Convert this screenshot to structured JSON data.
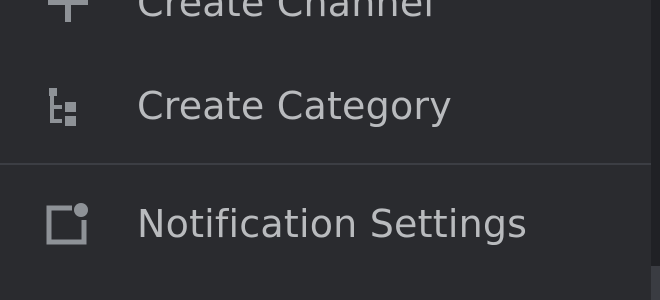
{
  "menu": {
    "items": [
      {
        "label": "Create Channel",
        "icon": "plus-icon"
      },
      {
        "label": "Create Category",
        "icon": "category-icon"
      },
      {
        "label": "Notification Settings",
        "icon": "notification-settings-icon"
      }
    ]
  },
  "colors": {
    "background": "#2a2b2f",
    "text": "#b9bbbe",
    "icon": "#8e9297",
    "divider": "#3c3e44"
  }
}
